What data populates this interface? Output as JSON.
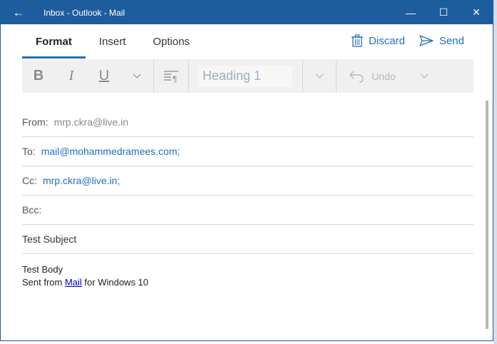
{
  "window": {
    "title": "Inbox - Outlook - Mail",
    "back_icon": "←",
    "minimize": "—",
    "maximize": "☐",
    "close": "✕"
  },
  "tabs": [
    {
      "label": "Format",
      "active": true
    },
    {
      "label": "Insert",
      "active": false
    },
    {
      "label": "Options",
      "active": false
    }
  ],
  "actions": {
    "discard_label": "Discard",
    "send_label": "Send"
  },
  "ribbon": {
    "bold": "B",
    "italic": "I",
    "underline": "U",
    "style_value": "Heading 1",
    "undo_label": "Undo"
  },
  "fields": {
    "from_label": "From:",
    "from_value": "mrp.ckra@live.in",
    "to_label": "To:",
    "to_value": "mail@mohammedramees.com;",
    "cc_label": "Cc:",
    "cc_value": "mrp.ckra@live.in;",
    "bcc_label": "Bcc:",
    "subject": "Test Subject"
  },
  "body": {
    "line1": "Test Body",
    "sent_prefix": "Sent from ",
    "mail_link": "Mail",
    "sent_suffix": " for Windows 10"
  },
  "colors": {
    "titlebar": "#1e5d9d",
    "accent": "#1e6fc0"
  }
}
